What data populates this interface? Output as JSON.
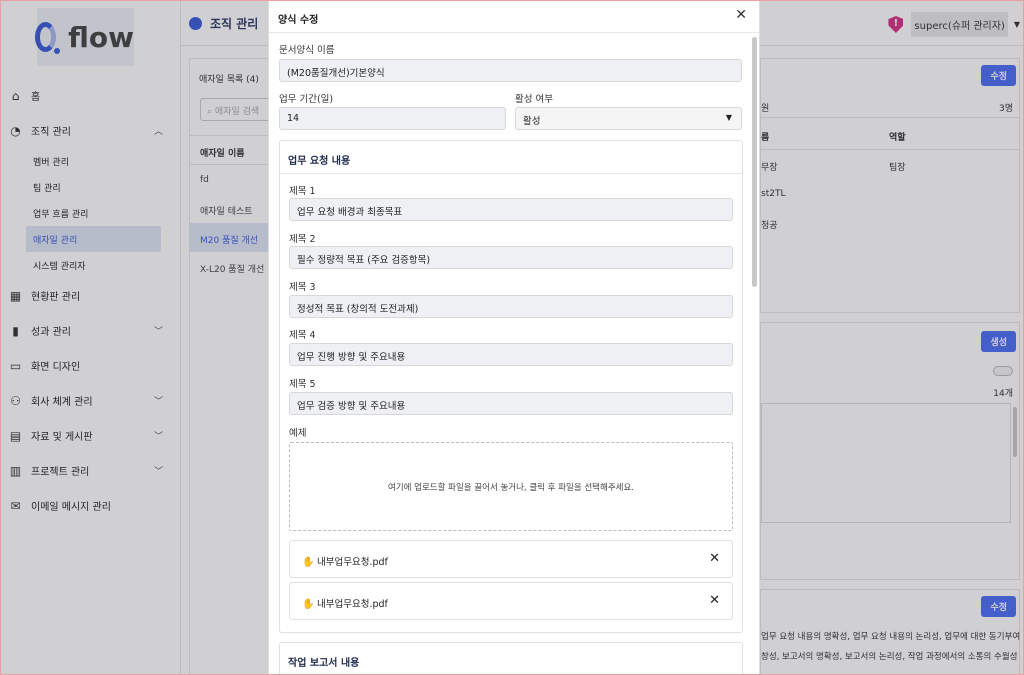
{
  "brand": {
    "logo_text": "flow"
  },
  "nav": {
    "home": "홈",
    "org": "조직 관리",
    "org_sub": [
      "멤버 관리",
      "팀 관리",
      "업무 흐름 관리",
      "애자일 관리",
      "시스템 관리자"
    ],
    "dashboard": "현황판 관리",
    "performance": "성과 관리",
    "screen": "화면 디자인",
    "company": "회사 체계 관리",
    "docs": "자료 및 게시판",
    "project": "프로젝트 관리",
    "email": "이메일 메시지 관리"
  },
  "header": {
    "title": "조직 관리",
    "user": "superc(슈퍼 관리자)",
    "shield": "!"
  },
  "list": {
    "header": "애자일 목록",
    "count": "(4)",
    "search_placeholder": "애자일 검색",
    "col": "애자일 이름",
    "rows": [
      "fd",
      "애자일 테스트",
      "M20 품질 개선",
      "X-L20 품질 개선"
    ]
  },
  "right": {
    "edit": "수정",
    "create": "생성",
    "count_label": "원",
    "count": "3명",
    "col_name": "름",
    "col_role": "역할",
    "rows": [
      [
        "무장",
        "팀장"
      ],
      [
        "st2TL",
        ""
      ],
      [
        "청공",
        ""
      ]
    ],
    "count2": "14개",
    "desc": [
      "업무 요청 내용의 명확성, 업무 요청 내용의 논리성, 업무에 대한 동기부여",
      "창성, 보고서의 명확성, 보고서의 논리성, 작업 과정에서의 소통의 수월성"
    ]
  },
  "modal": {
    "title": "양식 수정",
    "name_label": "문서양식 이름",
    "name_value": "(M20품질개선)기본양식",
    "period_label": "업무 기간(일)",
    "period_value": "14",
    "active_label": "활성 여부",
    "active_value": "활성",
    "request_section": "업무 요청 내용",
    "items": [
      {
        "label": "제목 1",
        "value": "업무 요청 배경과 최종목표"
      },
      {
        "label": "제목 2",
        "value": "필수 정량적 목표 (주요 검증항목)"
      },
      {
        "label": "제목 3",
        "value": "정성적 목표 (창의적 도전과제)"
      },
      {
        "label": "제목 4",
        "value": "업무 진행 방향 및 주요내용"
      },
      {
        "label": "제목 5",
        "value": "업무 검증 방향 및 주요내용"
      }
    ],
    "example_label": "예제",
    "drop_text": "여기에 업로드할 파일을 끌어서 놓거나, 클릭 후 파일을 선택해주세요.",
    "files": [
      "내부업무요청.pdf",
      "내부업무요청.pdf"
    ],
    "report_section": "작업 보고서 내용"
  }
}
